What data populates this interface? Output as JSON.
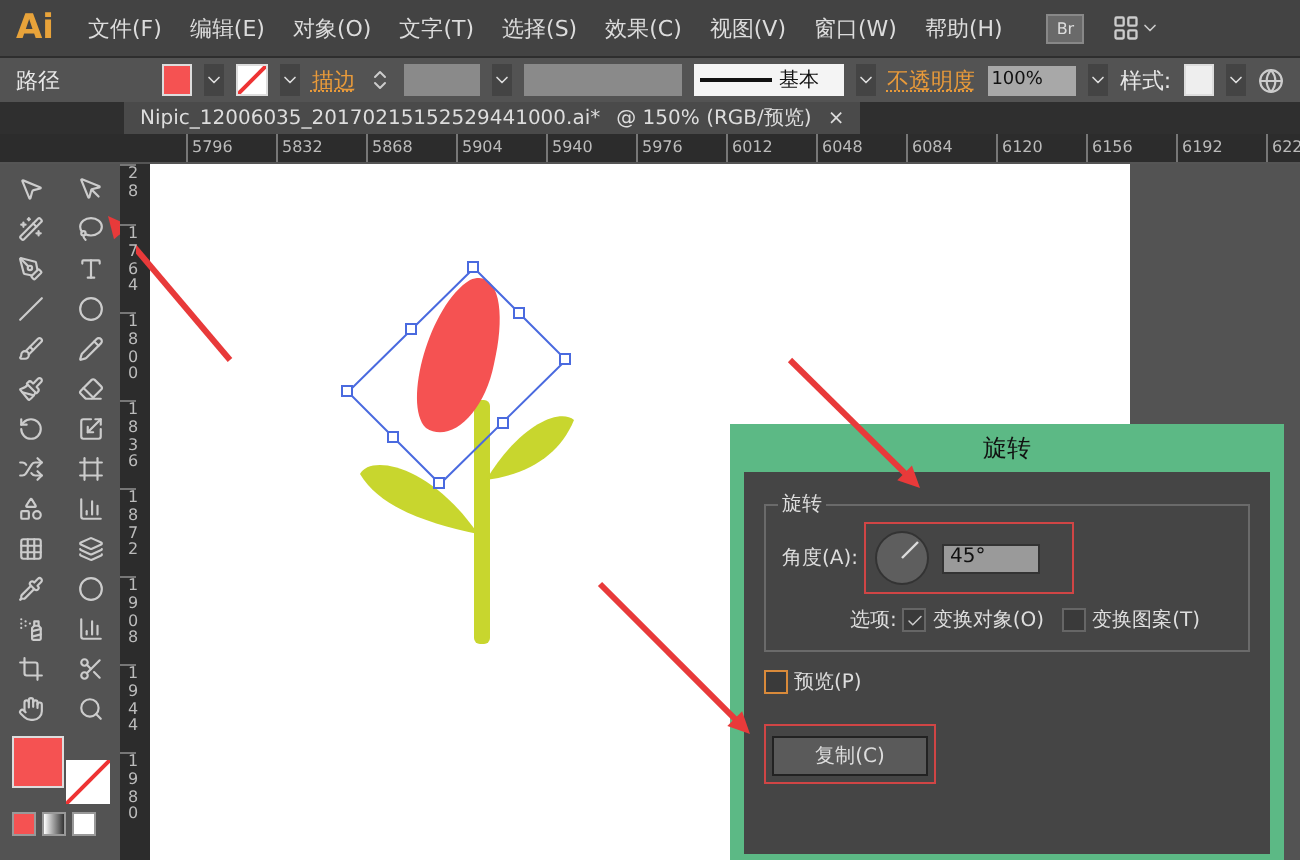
{
  "app": {
    "logo": "Ai"
  },
  "menu": [
    "文件(F)",
    "编辑(E)",
    "对象(O)",
    "文字(T)",
    "选择(S)",
    "效果(C)",
    "视图(V)",
    "窗口(W)",
    "帮助(H)"
  ],
  "menu_icons": {
    "bridge": "Br"
  },
  "control_bar": {
    "selection": "路径",
    "stroke_label": "描边",
    "stroke_style": "基本",
    "opacity_label": "不透明度",
    "opacity": "100%",
    "style_label": "样式:"
  },
  "document_tab": {
    "title": "Nipic_12006035_20170215152529441000.ai*",
    "info": "@  150%  (RGB/预览)",
    "close": "×"
  },
  "ruler": {
    "horizontal": [
      "5796",
      "5832",
      "5868",
      "5904",
      "5940",
      "5976",
      "6012",
      "6048",
      "6084",
      "6120",
      "6156",
      "6192",
      "622"
    ],
    "vertical": [
      "28",
      "1764",
      "1800",
      "1836",
      "1872",
      "1908",
      "1944",
      "1980"
    ]
  },
  "dialog": {
    "title": "旋转",
    "group_label": "旋转",
    "angle_label": "角度(A):",
    "angle": "45°",
    "options_label": "选项:",
    "options": [
      {
        "label": "变换对象(O)",
        "checked": true
      },
      {
        "label": "变换图案(T)",
        "checked": false
      }
    ],
    "preview": {
      "label": "预览(P)",
      "checked": false
    },
    "buttons": [
      "复制(C)"
    ]
  }
}
